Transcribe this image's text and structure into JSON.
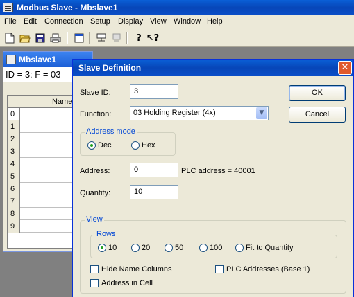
{
  "app": {
    "title": "Modbus Slave - Mbslave1"
  },
  "menu": [
    "File",
    "Edit",
    "Connection",
    "Setup",
    "Display",
    "View",
    "Window",
    "Help"
  ],
  "toolbar": {
    "icons": [
      "new-file-icon",
      "open-folder-icon",
      "save-icon",
      "print-icon",
      "window-icon",
      "connect-icon",
      "disconnect-icon",
      "help-icon",
      "context-help-icon"
    ]
  },
  "child": {
    "title": "Mbslave1",
    "status": "ID = 3: F = 03",
    "grid_header": "Name",
    "row_numbers": [
      "0",
      "1",
      "2",
      "3",
      "4",
      "5",
      "6",
      "7",
      "8",
      "9"
    ]
  },
  "dialog": {
    "title": "Slave Definition",
    "slave_id_label": "Slave ID:",
    "slave_id_value": "3",
    "function_label": "Function:",
    "function_value": "03 Holding Register (4x)",
    "ok_label": "OK",
    "cancel_label": "Cancel",
    "address_mode": {
      "legend": "Address mode",
      "dec": "Dec",
      "hex": "Hex",
      "selected": "Dec"
    },
    "address_label": "Address:",
    "address_value": "0",
    "plc_address_text": "PLC address = 40001",
    "quantity_label": "Quantity:",
    "quantity_value": "10",
    "view": {
      "legend": "View",
      "rows_legend": "Rows",
      "rows_options": [
        "10",
        "20",
        "50",
        "100",
        "Fit to Quantity"
      ],
      "rows_selected": "10",
      "hide_name_columns": "Hide Name Columns",
      "plc_addresses": "PLC Addresses (Base 1)",
      "address_in_cell": "Address in Cell"
    }
  },
  "colors": {
    "title_bar": "#0746b8",
    "dialog_bg": "#ece9d8",
    "close_button": "#e05a2c",
    "group_legend": "#0046d5"
  }
}
